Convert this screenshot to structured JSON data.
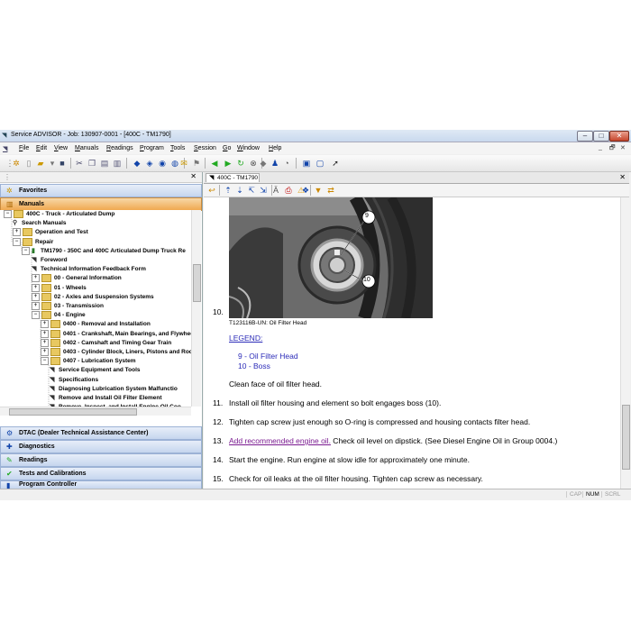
{
  "window": {
    "title": "Service ADVISOR - Job: 130907-0001 - [400C - TM1790]",
    "controls": [
      "–",
      "□",
      "✕"
    ]
  },
  "menu": {
    "items": [
      "File",
      "Edit",
      "View",
      "Manuals",
      "Readings",
      "Program",
      "Tools",
      "Session",
      "Go",
      "Window",
      "Help"
    ],
    "mdi_controls": [
      "_",
      "🗗",
      "✕"
    ]
  },
  "left_pane": {
    "close": "✕",
    "headers_top": [
      {
        "label": "Favorites",
        "icon": "star-icon"
      },
      {
        "label": "Manuals",
        "icon": "book-icon"
      }
    ],
    "tree": [
      {
        "label": "400C - Truck - Articulated Dump",
        "level": 0,
        "type": "folder",
        "toggle": "−"
      },
      {
        "label": "Search Manuals",
        "level": 1,
        "type": "search"
      },
      {
        "label": "Operation and Test",
        "level": 1,
        "type": "folder",
        "toggle": "+"
      },
      {
        "label": "Repair",
        "level": 1,
        "type": "folder",
        "toggle": "−"
      },
      {
        "label": "TM1790 - 350C and 400C Articulated Dump Truck Re",
        "level": 2,
        "type": "book",
        "toggle": "−"
      },
      {
        "label": "Foreword",
        "level": 3,
        "type": "page"
      },
      {
        "label": "Technical Information Feedback Form",
        "level": 3,
        "type": "page"
      },
      {
        "label": "00 - General Information",
        "level": 3,
        "type": "folder",
        "toggle": "+"
      },
      {
        "label": "01 - Wheels",
        "level": 3,
        "type": "folder",
        "toggle": "+"
      },
      {
        "label": "02 - Axles and Suspension Systems",
        "level": 3,
        "type": "folder",
        "toggle": "+"
      },
      {
        "label": "03 - Transmission",
        "level": 3,
        "type": "folder",
        "toggle": "+"
      },
      {
        "label": "04 - Engine",
        "level": 3,
        "type": "folder",
        "toggle": "−"
      },
      {
        "label": "0400 - Removal and Installation",
        "level": 4,
        "type": "folder",
        "toggle": "+"
      },
      {
        "label": "0401 - Crankshaft, Main Bearings, and Flywhee",
        "level": 4,
        "type": "folder",
        "toggle": "+"
      },
      {
        "label": "0402 - Camshaft and Timing Gear Train",
        "level": 4,
        "type": "folder",
        "toggle": "+"
      },
      {
        "label": "0403 - Cylinder Block, Liners, Pistons and Rods",
        "level": 4,
        "type": "folder",
        "toggle": "+"
      },
      {
        "label": "0407 - Lubrication System",
        "level": 4,
        "type": "folder",
        "toggle": "−"
      },
      {
        "label": "Service Equipment and Tools",
        "level": 5,
        "type": "page"
      },
      {
        "label": "Specifications",
        "level": 5,
        "type": "page"
      },
      {
        "label": "Diagnosing Lubrication System Malfunctio",
        "level": 5,
        "type": "page"
      },
      {
        "label": "Remove and Install Oil Filter Element",
        "level": 5,
        "type": "page"
      },
      {
        "label": "Remove, Inspect, and Install Engine Oil Coo",
        "level": 5,
        "type": "page"
      }
    ],
    "headers_bottom": [
      {
        "label": "DTAC (Dealer Technical Assistance Center)",
        "icon": "dtac-icon"
      },
      {
        "label": "Diagnostics",
        "icon": "diagnostics-icon"
      },
      {
        "label": "Readings",
        "icon": "readings-icon"
      },
      {
        "label": "Tests and Calibrations",
        "icon": "tests-icon"
      },
      {
        "label": "Program Controller",
        "icon": "controller-icon"
      }
    ]
  },
  "content": {
    "tab_label": "400C - TM1790",
    "tab_close": "✕",
    "figure": {
      "callout_top": "9",
      "callout_bottom": "10",
      "caption": "T123116B-UN: Oil Filter Head"
    },
    "step10_num": "10.",
    "legend_title": "LEGEND:",
    "legend_items": [
      "9 - Oil Filter Head",
      "10 - Boss"
    ],
    "clean_text": "Clean face of oil filter head.",
    "steps": [
      {
        "num": "11.",
        "text": "Install oil filter housing and element so bolt engages boss (10)."
      },
      {
        "num": "12.",
        "text": "Tighten cap screw just enough so O-ring is compressed and housing contacts filter head."
      },
      {
        "num": "13.",
        "link": "Add recommended engine oil.",
        "text": " Check oil level on dipstick. (See Diesel Engine Oil in Group 0004.)"
      },
      {
        "num": "14.",
        "text": "Start the engine. Run engine at slow idle for approximately one minute."
      },
      {
        "num": "15.",
        "text": "Check for oil leaks at the oil filter housing. Tighten cap screw as necessary."
      }
    ]
  },
  "status": [
    "CAP",
    "NUM",
    "SCRL"
  ]
}
